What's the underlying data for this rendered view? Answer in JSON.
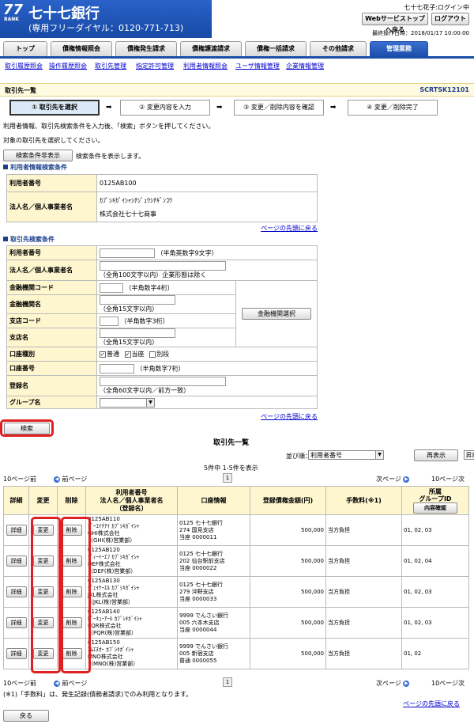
{
  "header": {
    "logo_num": "77",
    "logo_bank": "BANK",
    "bank_name": "七十七銀行",
    "tel": "(専用フリーダイヤル：0120-771-713)",
    "user_status": "七十七花子:ログイン中",
    "top_button": "Webサービストップへ戻る",
    "logout_button": "ログアウト",
    "last_op": "最終操作日時：2018/01/17 10:00:00"
  },
  "tabs": [
    "トップ",
    "債権情報照会",
    "債権発生請求",
    "債権譲渡請求",
    "債権一括請求",
    "その他請求",
    "管理業務"
  ],
  "subnav": [
    "取引履歴照会",
    "操作履歴照会",
    "取引先管理",
    "指定許可管理",
    "利用者情報照会",
    "ユーザ情報管理",
    "企業情報管理"
  ],
  "page": {
    "title": "取引先一覧",
    "code": "SCRTSK12101"
  },
  "steps": [
    "① 取引先を選択",
    "② 変更内容を入力",
    "③ 変更／削除内容を確認",
    "④ 変更／削除完了"
  ],
  "instructions": {
    "line1": "利用者情報、取引先検索条件を入力後、「検索」ボタンを押してください。",
    "line2": "対象の取引先を選択してください。",
    "hide_button": "検索条件非表示",
    "hide_note": "検索条件を表示します。"
  },
  "user_info": {
    "section": "利用者情報検索条件",
    "rows": [
      {
        "label": "利用者番号",
        "value": "0125AB100"
      },
      {
        "label": "法人名／個人事業者名",
        "value": "ｶﾌﾞｼｷｶﾞｲｼｬｼﾁｼﾞｭｳｼﾁｷﾞﾝｺｳ",
        "value2": "株式会社七十七商事"
      }
    ],
    "page_top": "ページの先頭に戻る"
  },
  "search": {
    "section": "取引先検索条件",
    "user_no": {
      "label": "利用者番号",
      "hint": "（半角英数字9文字）"
    },
    "corp_name": {
      "label": "法人名／個人事業者名",
      "hint": "（全角100文字以内）企業形態は除く"
    },
    "bank_code": {
      "label": "金融機関コード",
      "hint": "（半角数字4桁）"
    },
    "bank_name": {
      "label": "金融機関名",
      "hint": "（全角15文字以内）"
    },
    "branch_code": {
      "label": "支店コード",
      "hint": "（半角数字3桁）"
    },
    "branch_name": {
      "label": "支店名",
      "hint": "（全角15文字以内）"
    },
    "account_type": {
      "label": "口座種別",
      "options": [
        "普通",
        "当座",
        "別段"
      ]
    },
    "account_no": {
      "label": "口座番号",
      "hint": "（半角数字7桁）"
    },
    "reg_name": {
      "label": "登録名",
      "hint": "（全角60文字以内／前方一致）"
    },
    "group": {
      "label": "グループ名"
    },
    "bank_search_button": "金融機関選択",
    "page_top": "ページの先頭に戻る",
    "search_button": "検索"
  },
  "results": {
    "title": "取引先一覧",
    "sort_label": "並び順：",
    "sort_value": "利用者番号",
    "order_value": "昇順",
    "redisplay": "再表示",
    "count": "5件中 1-5件を表示",
    "prev10": "10ページ前",
    "prev": "前ページ",
    "page": "1",
    "next": "次ページ",
    "next10": "10ページ次",
    "headers": {
      "detail": "詳細",
      "change": "変更",
      "delete": "削除",
      "name": "利用者番号\n法人名／個人事業者名\n（登録名）",
      "account": "口座情報",
      "amount": "登録債権金額(円)",
      "fee": "手数料(※1)",
      "group": "所属\nグループID",
      "group_btn": "内容確認"
    },
    "detail_btn": "詳細",
    "change_btn": "変更",
    "delete_btn": "削除",
    "rows": [
      {
        "id": "0125AB110",
        "kana": "ｼﾞｰｴｲﾁｱｲ ｶﾌﾞｼｷｶﾞｲｼｬ",
        "name": "GHI株式会社",
        "reg": "（GHI(株)営業部）",
        "bank": "0125 七十七銀行",
        "branch": "274 国見支店",
        "acct": "当座 0000011",
        "amount": "500,000",
        "fee": "当方負担",
        "group": "01, 02, 03"
      },
      {
        "id": "0125AB120",
        "kana": "ﾃﾞｨｰｲｰｴﾌ ｶﾌﾞｼｷｶﾞｲｼｬ",
        "name": "DEF株式会社",
        "reg": "（DEF(株)営業部）",
        "bank": "0125 七十七銀行",
        "branch": "202 仙台駅前支店",
        "acct": "当座 0000022",
        "amount": "500,000",
        "fee": "当方負担",
        "group": "01, 02, 04"
      },
      {
        "id": "0125AB130",
        "kana": "ｼﾞｪｲｹｰｴﾙ ｶﾌﾞｼｷｶﾞｲｼｬ",
        "name": "JKL株式会社",
        "reg": "（JKL(株)営業部）",
        "bank": "0125 七十七銀行",
        "branch": "279 沖野支店",
        "acct": "当座 0000033",
        "amount": "500,000",
        "fee": "当方負担",
        "group": "01, 02, 03"
      },
      {
        "id": "0125AB140",
        "kana": "ﾋﾟｰｷｭｰｱｰﾙ ｶﾌﾞｼｷｶﾞｲｼｬ",
        "name": "PQR株式会社",
        "reg": "（PQR(株)営業部）",
        "bank": "9999 でんさい銀行",
        "branch": "005 六本木支店",
        "acct": "当座 0000044",
        "amount": "500,000",
        "fee": "当方負担",
        "group": "01, 02, 03"
      },
      {
        "id": "0125AB150",
        "kana": "ｴﾑｴﾇｵｰ ｶﾌﾞｼｷｶﾞｲｼｬ",
        "name": "MNO株式会社",
        "reg": "（MNO(株)営業部）",
        "bank": "9999 でんさい銀行",
        "branch": "005 新宿支店",
        "acct": "普通 0000055",
        "amount": "500,000",
        "fee": "当方負担",
        "group": "01, 02"
      }
    ],
    "footnote": "(※1)「手数料」は、発生記録(債務者請求)でのみ利用となります。",
    "page_top": "ページの先頭に戻る",
    "back_button": "戻る"
  }
}
